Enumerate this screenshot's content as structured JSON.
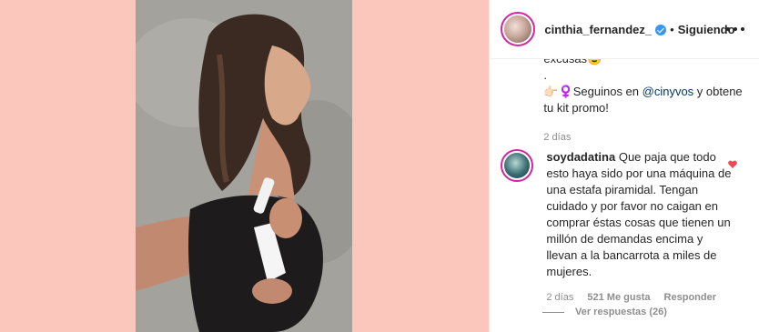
{
  "header": {
    "username": "cinthia_fernandez_",
    "separator": "•",
    "follow_status": "Siguiendo"
  },
  "caption": {
    "line_partial": "excusas😉",
    "line_dot": ".",
    "cta_prefix": "👉🏻♀️Seguinos en ",
    "mention": "@cinyvos",
    "cta_suffix": " y obtene tu kit promo!",
    "time": "2 días"
  },
  "comment": {
    "username": "soydadatina",
    "text": " Que paja que todo esto haya sido por una máquina de una estafa piramidal. Tengan cuidado y por favor no caigan en comprar éstas cosas que tienen un millón de demandas encima y llevan a la bancarrota a miles de mujeres.",
    "time": "2 días",
    "likes": "521 Me gusta",
    "reply": "Responder",
    "view_replies": "Ver respuestas (26)"
  },
  "colors": {
    "media_bg": "#fbc6bb",
    "text": "#262626",
    "meta": "#8e8e8e",
    "mention": "#00376b",
    "heart": "#ed4956",
    "verified": "#3897f0"
  }
}
